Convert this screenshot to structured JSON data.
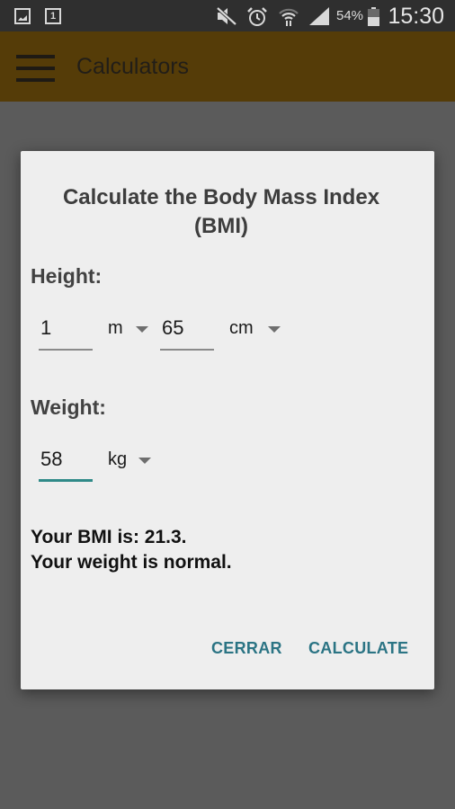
{
  "status_bar": {
    "left_icons": [
      "gallery-icon",
      "calendar-icon"
    ],
    "calendar_day": "1",
    "right_icons": [
      "mute-icon",
      "alarm-icon",
      "wifi-icon",
      "signal-icon",
      "battery-icon"
    ],
    "battery_percent_label": "54%",
    "battery_level": 0.54,
    "time": "15:30"
  },
  "app_bar": {
    "title": "Calculators",
    "menu_icon": "hamburger-menu-icon",
    "background_color": "#553c08"
  },
  "dialog": {
    "title_line1": "Calculate the Body Mass Index",
    "title_line2": "(BMI)",
    "height": {
      "label": "Height:",
      "value1": "1",
      "unit1": "m",
      "value2": "65",
      "unit2": "cm"
    },
    "weight": {
      "label": "Weight:",
      "value": "58",
      "unit": "kg"
    },
    "result_line1": "Your BMI is: 21.3.",
    "result_line2": "Your weight is normal.",
    "buttons": {
      "close_label": "CERRAR",
      "calculate_label": "CALCULATE"
    },
    "accent_color": "#2b7484"
  }
}
